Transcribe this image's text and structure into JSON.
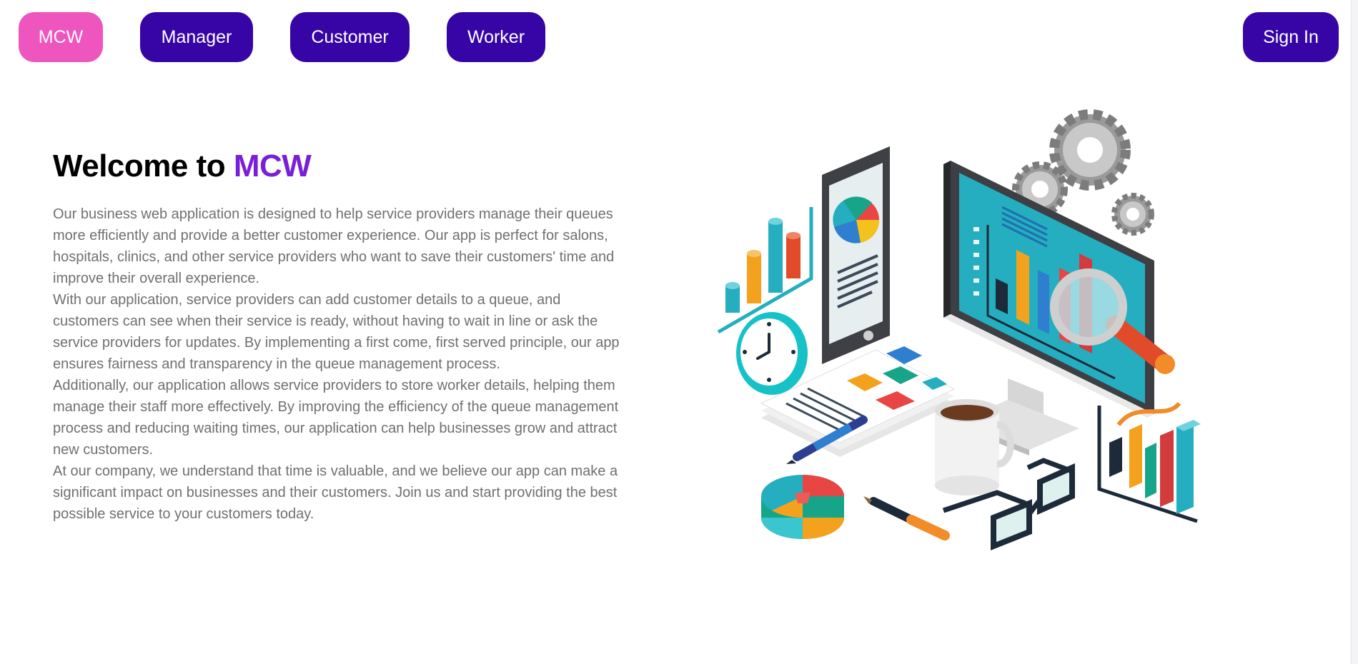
{
  "nav": {
    "home_label": "MCW",
    "manager_label": "Manager",
    "customer_label": "Customer",
    "worker_label": "Worker",
    "signin_label": "Sign In"
  },
  "hero": {
    "title_prefix": "Welcome to ",
    "title_brand": "MCW",
    "paragraphs": [
      "Our business web application is designed to help service providers manage their queues more efficiently and provide a better customer experience. Our app is perfect for salons, hospitals, clinics, and other service providers who want to save their customers' time and improve their overall experience.",
      "With our application, service providers can add customer details to a queue, and customers can see when their service is ready, without having to wait in line or ask the service providers for updates. By implementing a first come, first served principle, our app ensures fairness and transparency in the queue management process.",
      "Additionally, our application allows service providers to store worker details, helping them manage their staff more effectively. By improving the efficiency of the queue management process and reducing waiting times, our application can help businesses grow and attract new customers.",
      "At our company, we understand that time is valuable, and we believe our app can make a significant impact on businesses and their customers. Join us and start providing the best possible service to your customers today."
    ]
  },
  "illustration": {
    "icon": "business-analytics-illustration"
  },
  "colors": {
    "home_button": "#ee55be",
    "nav_button": "#3704a6",
    "brand_text": "#7a1fd6",
    "body_text": "#707070"
  }
}
